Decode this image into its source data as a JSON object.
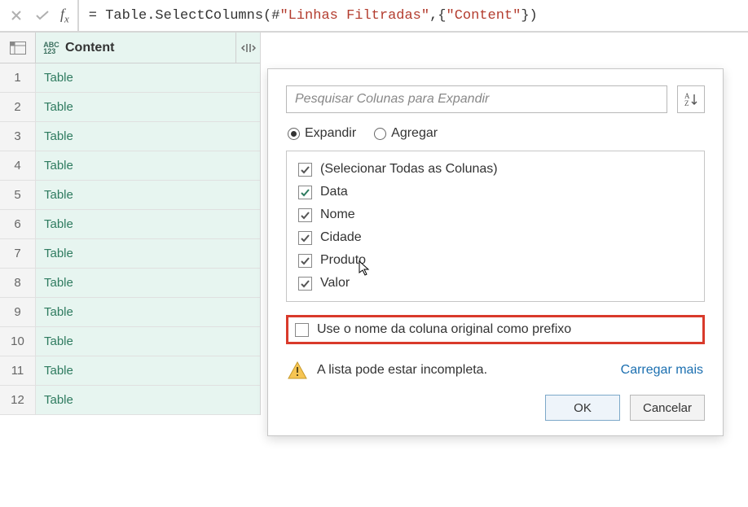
{
  "formula": {
    "eq": "= ",
    "fn": "Table.SelectColumns",
    "hash": "#",
    "arg1": "\"Linhas Filtradas\"",
    "sep": ",",
    "arg2": "\"Content\""
  },
  "grid": {
    "type_label_top": "ABC",
    "type_label_bottom": "123",
    "column_name": "Content",
    "rows": [
      {
        "n": "1",
        "v": "Table"
      },
      {
        "n": "2",
        "v": "Table"
      },
      {
        "n": "3",
        "v": "Table"
      },
      {
        "n": "4",
        "v": "Table"
      },
      {
        "n": "5",
        "v": "Table"
      },
      {
        "n": "6",
        "v": "Table"
      },
      {
        "n": "7",
        "v": "Table"
      },
      {
        "n": "8",
        "v": "Table"
      },
      {
        "n": "9",
        "v": "Table"
      },
      {
        "n": "10",
        "v": "Table"
      },
      {
        "n": "11",
        "v": "Table"
      },
      {
        "n": "12",
        "v": "Table"
      }
    ]
  },
  "popup": {
    "search_placeholder": "Pesquisar Colunas para Expandir",
    "radio_expand": "Expandir",
    "radio_aggregate": "Agregar",
    "select_all": "(Selecionar Todas as Colunas)",
    "columns": [
      {
        "label": "Data",
        "checked": true,
        "green": true
      },
      {
        "label": "Nome",
        "checked": true,
        "green": false
      },
      {
        "label": "Cidade",
        "checked": true,
        "green": false
      },
      {
        "label": "Produto",
        "checked": true,
        "green": false
      },
      {
        "label": "Valor",
        "checked": true,
        "green": false
      }
    ],
    "prefix_label": "Use o nome da coluna original como prefixo",
    "warning": "A lista pode estar incompleta.",
    "load_more": "Carregar mais",
    "ok": "OK",
    "cancel": "Cancelar"
  }
}
